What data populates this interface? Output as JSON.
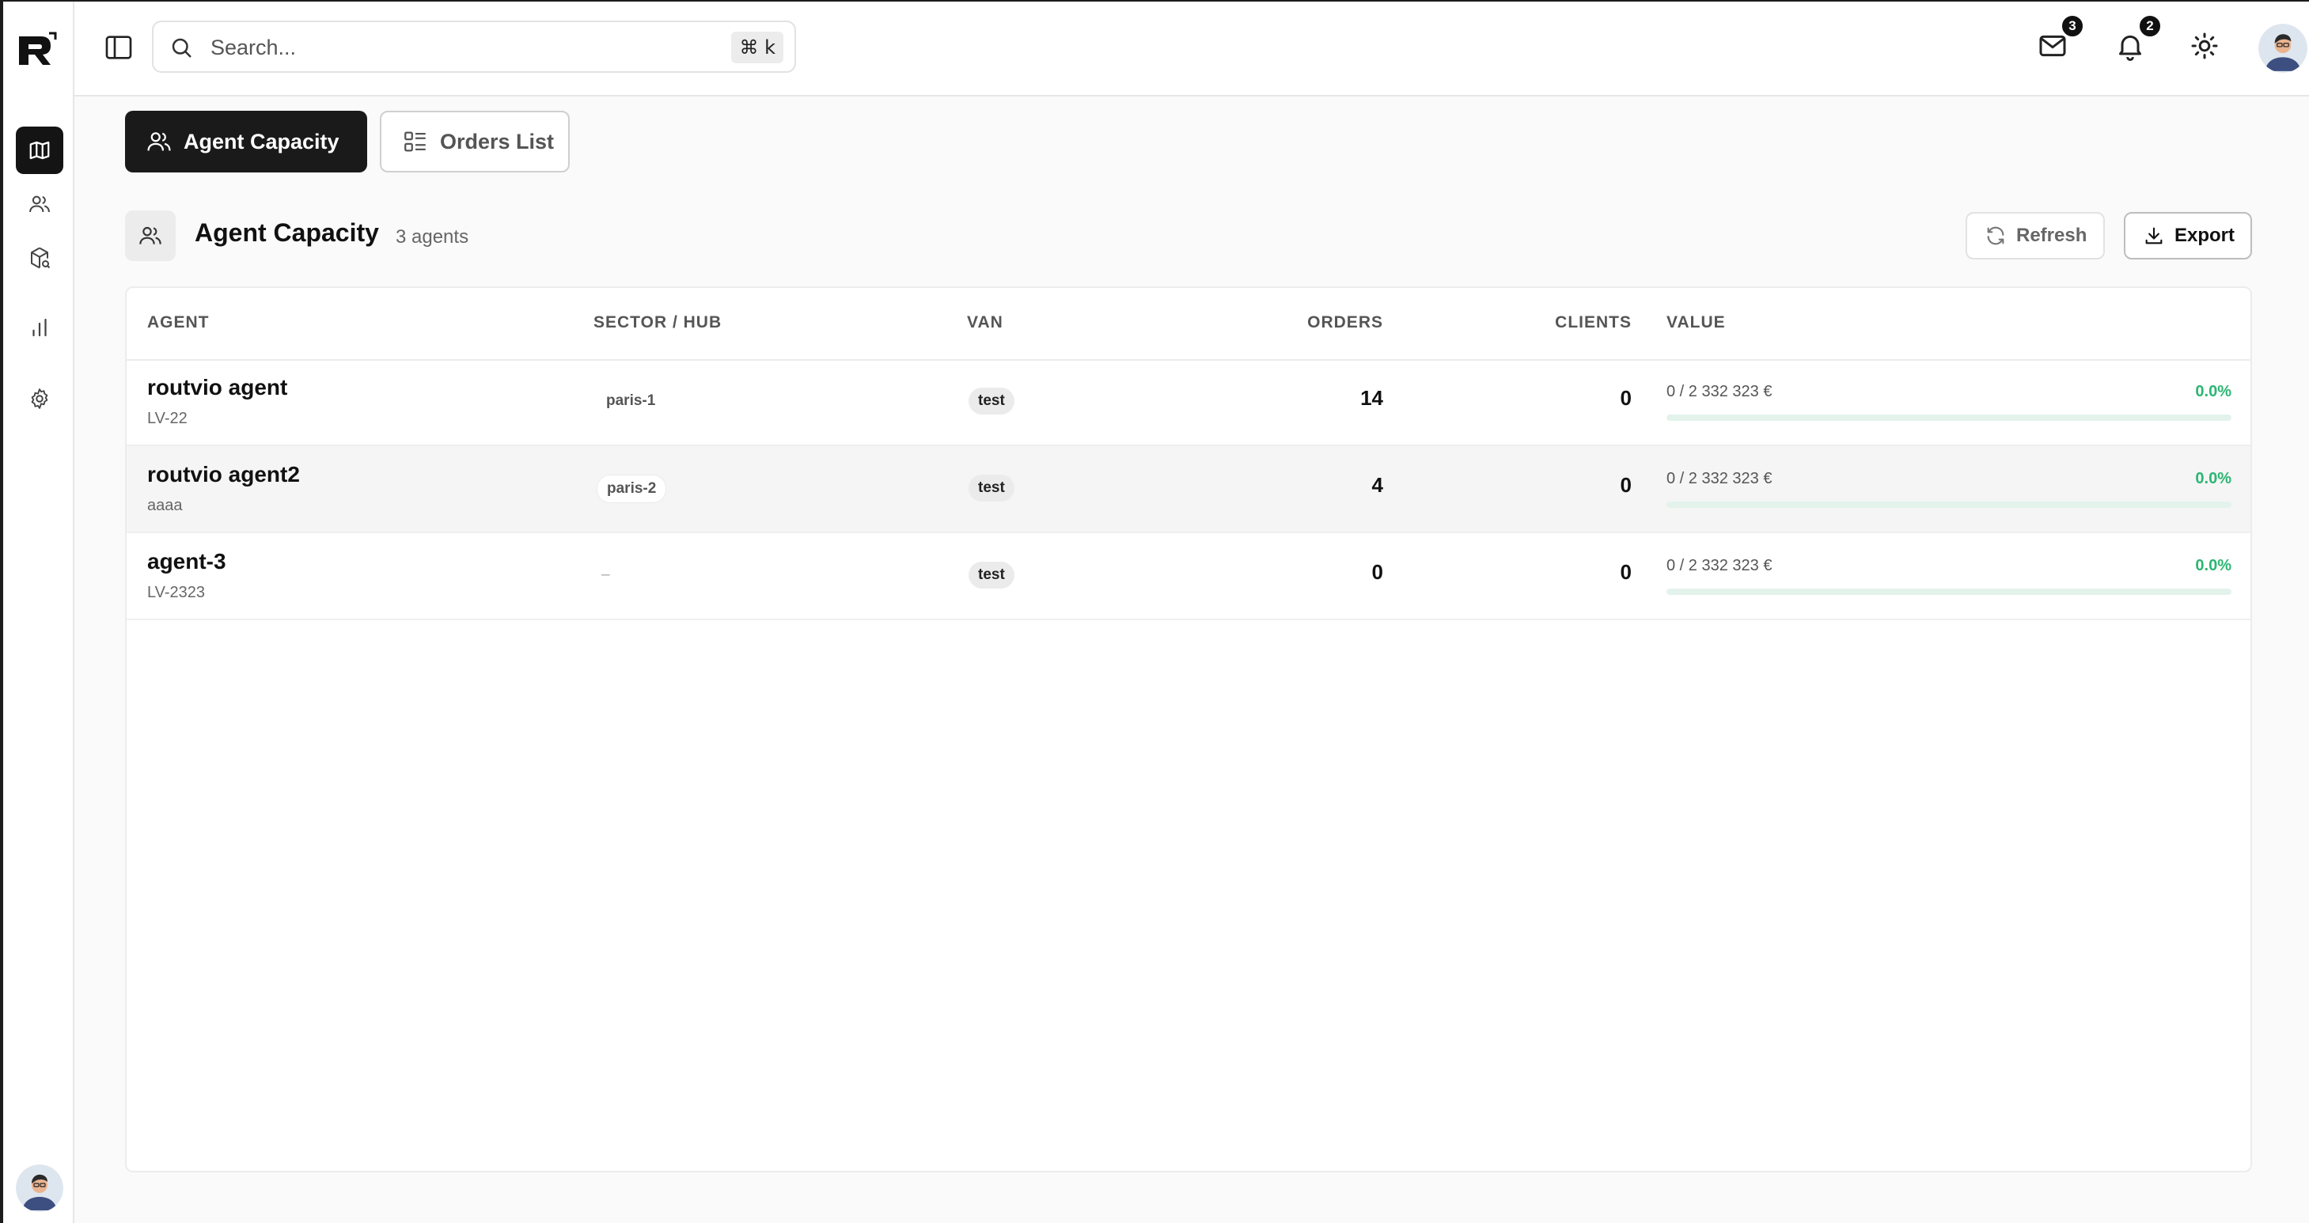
{
  "header": {
    "search_placeholder": "Search...",
    "shortcut": "⌘ k",
    "mail_count": "3",
    "notif_count": "2"
  },
  "sidebar": {
    "items": [
      {
        "name": "map",
        "active": true
      },
      {
        "name": "users",
        "active": false
      },
      {
        "name": "packages",
        "active": false
      },
      {
        "name": "analytics",
        "active": false
      },
      {
        "name": "settings",
        "active": false
      }
    ]
  },
  "tabs": [
    {
      "label": "Agent Capacity",
      "active": true
    },
    {
      "label": "Orders List",
      "active": false
    }
  ],
  "section": {
    "title": "Agent Capacity",
    "count": "3 agents",
    "refresh_label": "Refresh",
    "export_label": "Export"
  },
  "table": {
    "headers": {
      "agent": "AGENT",
      "sector": "SECTOR / HUB",
      "van": "VAN",
      "orders": "ORDERS",
      "clients": "CLIENTS",
      "value": "VALUE"
    },
    "rows": [
      {
        "name": "routvio agent",
        "code": "LV-22",
        "hub": "paris-1",
        "van": "test",
        "orders": "14",
        "clients": "0",
        "value": "0 / 2 332 323 €",
        "pct": "0.0%",
        "fill": 0.0
      },
      {
        "name": "routvio agent2",
        "code": "aaaa",
        "hub": "paris-2",
        "van": "test",
        "orders": "4",
        "clients": "0",
        "value": "0 / 2 332 323 €",
        "pct": "0.0%",
        "fill": 0.0
      },
      {
        "name": "agent-3",
        "code": "LV-2323",
        "hub": "–",
        "van": "test",
        "orders": "0",
        "clients": "0",
        "value": "0 / 2 332 323 €",
        "pct": "0.0%",
        "fill": 0.0
      }
    ]
  },
  "colors": {
    "accent_green": "#2bb673",
    "active_dark": "#1a1a1a"
  }
}
